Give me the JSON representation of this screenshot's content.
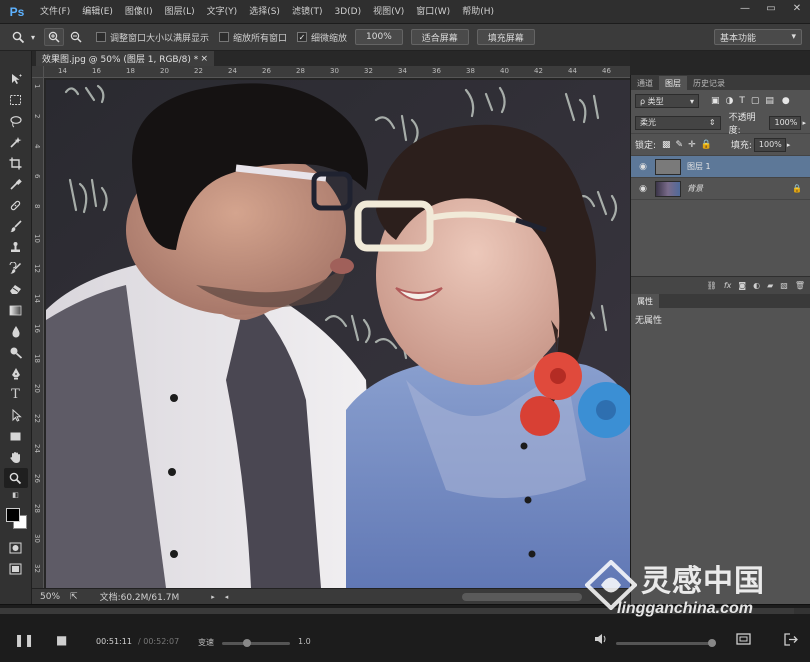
{
  "app": {
    "logo": "Ps",
    "menu": [
      "文件(F)",
      "编辑(E)",
      "图像(I)",
      "图层(L)",
      "文字(Y)",
      "选择(S)",
      "滤镜(T)",
      "3D(D)",
      "视图(V)",
      "窗口(W)",
      "帮助(H)"
    ],
    "window_controls": [
      "—",
      "▭",
      "✕"
    ]
  },
  "options": {
    "resize_windows": "调整窗口大小以满屏显示",
    "zoom_all_windows": "缩放所有窗口",
    "scrubby_zoom": "细微缩放",
    "zoom_100": "100%",
    "fit_screen": "适合屏幕",
    "fill_screen": "填充屏幕",
    "workspace": "基本功能"
  },
  "document": {
    "tab_title": "效果图.jpg @ 50% (图层 1, RGB/8) *",
    "close": "×",
    "zoom": "50%",
    "doc_size": "文档:60.2M/61.7M",
    "ruler_h": [
      "14",
      "16",
      "18",
      "20",
      "22",
      "24",
      "26",
      "28",
      "30",
      "32",
      "34",
      "36",
      "38",
      "40",
      "42",
      "44",
      "46"
    ],
    "ruler_v": [
      "1",
      "2",
      "4",
      "6",
      "8",
      "10",
      "12",
      "14",
      "16",
      "18",
      "20",
      "22",
      "24",
      "26",
      "28",
      "30",
      "32"
    ]
  },
  "layers_panel": {
    "tabs": [
      "通道",
      "图层",
      "历史记录"
    ],
    "filter_kind": "ρ 类型",
    "blend_mode": "柔光",
    "opacity_label": "不透明度:",
    "opacity_value": "100%",
    "lock_label": "锁定:",
    "fill_label": "填充:",
    "fill_value": "100%",
    "layers": [
      {
        "name": "图层 1",
        "selected": true
      },
      {
        "name": "背景",
        "selected": false,
        "locked": true
      }
    ],
    "footer_icons": [
      "link-icon",
      "fx-icon",
      "mask-icon",
      "adjustment-icon",
      "folder-icon",
      "new-layer-icon",
      "trash-icon"
    ]
  },
  "properties_panel": {
    "tab": "属性",
    "body": "无属性"
  },
  "player": {
    "current_time": "00:51:11",
    "total_time": "/ 00:52:07",
    "speed_label": "变速",
    "speed_value": "1.0",
    "progress": 0.98
  },
  "watermark": {
    "main": "灵感中国",
    "sub": "lingganchina.com"
  }
}
